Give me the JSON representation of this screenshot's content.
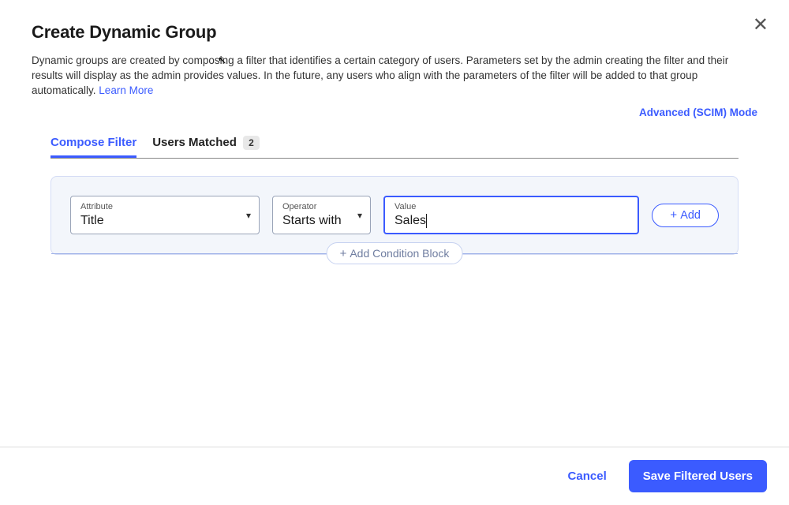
{
  "header": {
    "title": "Create Dynamic Group",
    "description": "Dynamic groups are created by composing a filter that identifies a certain category of users. Parameters set by the admin creating the filter and their results will display as the admin provides values. In the future, any users who align with the parameters of the filter will be added to that group automatically. ",
    "learn_more": "Learn More",
    "advanced_mode": "Advanced (SCIM) Mode"
  },
  "tabs": {
    "compose": "Compose Filter",
    "matched": "Users Matched",
    "matched_count": "2"
  },
  "filter": {
    "attribute_label": "Attribute",
    "attribute_value": "Title",
    "operator_label": "Operator",
    "operator_value": "Starts with",
    "value_label": "Value",
    "value_value": "Sales",
    "add_button": "Add",
    "add_block": "Add Condition Block"
  },
  "footer": {
    "cancel": "Cancel",
    "save": "Save Filtered Users"
  }
}
